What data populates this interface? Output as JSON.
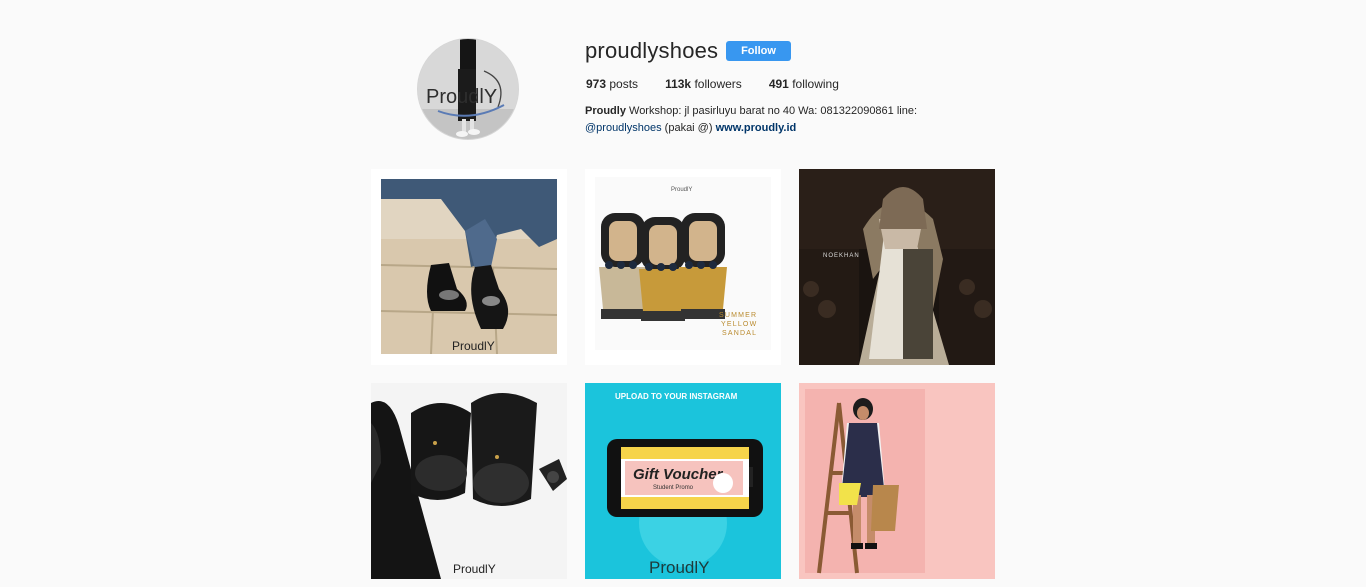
{
  "profile": {
    "username": "proudlyshoes",
    "follow_label": "Follow",
    "avatar_logo_text": "ProudlY",
    "stats": {
      "posts_count": "973",
      "posts_label": "posts",
      "followers_count": "113k",
      "followers_label": "followers",
      "following_count": "491",
      "following_label": "following"
    },
    "bio": {
      "name": "Proudly",
      "text": " Workshop: jl pasirluyu barat no 40 Wa: 081322090861 line:",
      "mention": "@proudlyshoes",
      "after_mention": " (pakai @) ",
      "website": "www.proudly.id"
    }
  },
  "posts": [
    {
      "watermark": "ProudlY"
    },
    {
      "watermark": "ProudlY",
      "caption_lines": [
        "SUMMER",
        "YELLOW",
        "SANDAL"
      ]
    },
    {
      "watermark": "NOEKHAN"
    },
    {
      "watermark": "ProudlY"
    },
    {
      "header": "UPLOAD TO YOUR INSTAGRAM",
      "title": "Gift Voucher",
      "subtitle": "Student Promo",
      "watermark": "ProudlY"
    },
    {
      "watermark": ""
    }
  ],
  "colors": {
    "follow_button": "#3897f0",
    "voucher_background": "#1bc4dc",
    "pink_background": "#f9c5c0",
    "link": "#003569"
  }
}
